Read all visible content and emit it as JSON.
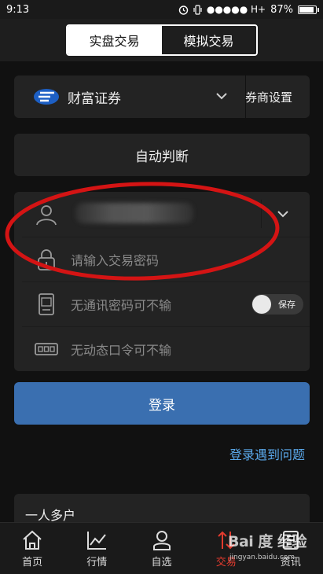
{
  "status": {
    "time": "9:13",
    "carrier": "●●●●● H+",
    "battery": "87%",
    "battery_level": 0.87
  },
  "mode_switch": {
    "options": [
      "实盘交易",
      "模拟交易"
    ],
    "selected": 0
  },
  "broker": {
    "name": "财富证券",
    "settings_label": "券商设置",
    "logo_icon": "broker-logo-icon",
    "chevron_icon": "chevron-down-icon"
  },
  "auto_detect": {
    "label": "自动判断"
  },
  "form": {
    "account": {
      "icon": "user-icon",
      "value": "",
      "chevron_icon": "chevron-down-icon"
    },
    "password": {
      "icon": "lock-icon",
      "placeholder": "请输入交易密码"
    },
    "comm_password": {
      "icon": "tablet-icon",
      "placeholder": "无通讯密码可不输",
      "save_toggle_label": "保存",
      "save_on": false
    },
    "dynamic_code": {
      "icon": "keypad-icon",
      "placeholder": "无动态口令可不输"
    }
  },
  "login_button": {
    "label": "登录"
  },
  "help_link": {
    "label": "登录遇到问题"
  },
  "multi_account": {
    "label": "一人多户"
  },
  "tabbar": {
    "items": [
      {
        "label": "首页",
        "icon": "home-icon"
      },
      {
        "label": "行情",
        "icon": "chart-icon"
      },
      {
        "label": "自选",
        "icon": "person-icon"
      },
      {
        "label": "交易",
        "icon": "trade-arrows-icon"
      },
      {
        "label": "资讯",
        "icon": "news-icon"
      }
    ],
    "active": 3
  },
  "watermark": {
    "logo": "Bai 度 经验",
    "url": "jingyan.baidu.com"
  },
  "colors": {
    "accent": "#3a6fb0",
    "link": "#5aa8ea",
    "active_tab": "#e23b2e",
    "annotation": "#d41414"
  }
}
